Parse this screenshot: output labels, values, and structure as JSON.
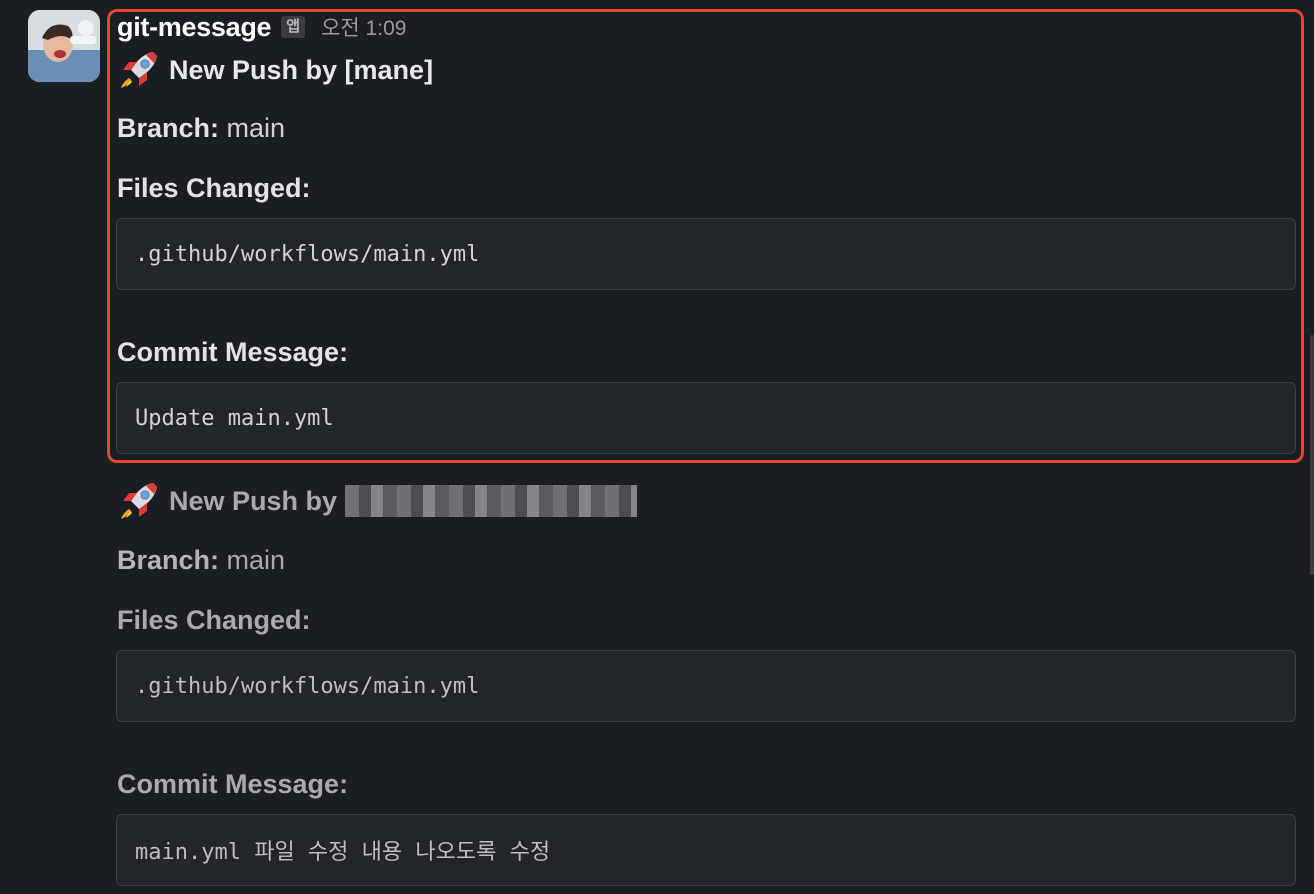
{
  "app": {
    "sender": "git-message",
    "badge": "앱",
    "timestamp": "오전 1:09"
  },
  "icons": {
    "avatar": "avatar-photo",
    "rocket": "rocket-emoji",
    "redacted": "pixelated-redaction"
  },
  "colors": {
    "background": "#1a1d21",
    "highlight": "#e8482b",
    "codebox_bg": "#222529"
  },
  "messages": [
    {
      "title": "New Push by [mane]",
      "branch_label": "Branch:",
      "branch_value": " main",
      "files_label": "Files Changed:",
      "files_value": ".github/workflows/main.yml",
      "commit_label": "Commit Message:",
      "commit_value": "Update main.yml"
    },
    {
      "title": "New Push by",
      "branch_label": "Branch:",
      "branch_value": " main",
      "files_label": "Files Changed:",
      "files_value": ".github/workflows/main.yml",
      "commit_label": "Commit Message:",
      "commit_value": "main.yml 파일 수정 내용 나오도록 수정"
    }
  ]
}
